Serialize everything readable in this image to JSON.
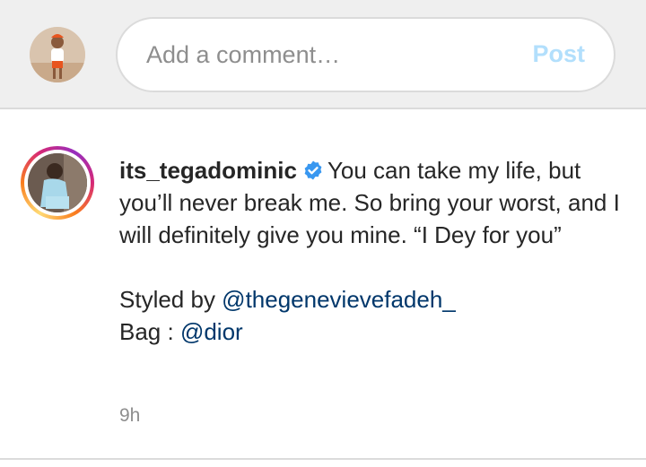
{
  "comment_bar": {
    "placeholder": "Add a comment…",
    "post_label": "Post"
  },
  "caption": {
    "username": "its_tegadominic",
    "verified_icon": "verified-badge-icon",
    "text_line": "You can take my life, but you’ll never break me. So bring your worst, and I will definitely give you mine. “I Dey for you”",
    "styled_by_label": "Styled by ",
    "styled_by_handle": "@thegenevievefadeh_",
    "bag_label": "Bag : ",
    "bag_handle": "@dior",
    "timestamp": "9h"
  },
  "colors": {
    "post_button": "#b2dffc",
    "mention": "#00376b",
    "verified": "#3897f0",
    "muted": "#8e8e8e"
  }
}
